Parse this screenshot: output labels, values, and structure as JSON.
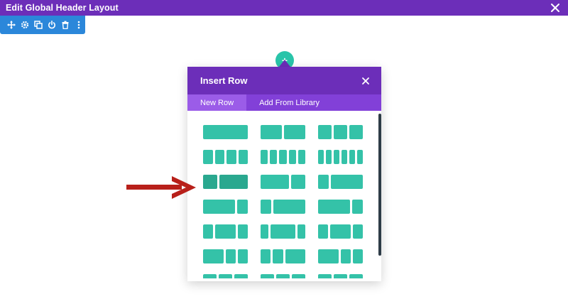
{
  "topbar": {
    "title": "Edit Global Header Layout",
    "close_icon": "close-icon"
  },
  "section_toolbar": {
    "color": "#2b87da",
    "icons": [
      "move-icon",
      "gear-icon",
      "duplicate-icon",
      "power-icon",
      "trash-icon",
      "more-vertical-icon"
    ]
  },
  "add_button": {
    "icon": "plus-icon",
    "label": "+",
    "color": "#29c4a9"
  },
  "modal": {
    "title": "Insert Row",
    "close_icon": "close-icon",
    "tabs": [
      {
        "label": "New Row",
        "active": true
      },
      {
        "label": "Add From Library",
        "active": false
      }
    ],
    "accent": "#6c2eb9",
    "layout_color": "#34c2a8",
    "layouts": [
      {
        "row": 0,
        "col": 0,
        "columns": [
          "1"
        ]
      },
      {
        "row": 0,
        "col": 1,
        "columns": [
          "1/2",
          "1/2"
        ]
      },
      {
        "row": 0,
        "col": 2,
        "columns": [
          "1/3",
          "1/3",
          "1/3"
        ]
      },
      {
        "row": 1,
        "col": 0,
        "columns": [
          "1/4",
          "1/4",
          "1/4",
          "1/4"
        ]
      },
      {
        "row": 1,
        "col": 1,
        "columns": [
          "1/5",
          "1/5",
          "1/5",
          "1/5",
          "1/5"
        ]
      },
      {
        "row": 1,
        "col": 2,
        "columns": [
          "1/6",
          "1/6",
          "1/6",
          "1/6",
          "1/6",
          "1/6"
        ]
      },
      {
        "row": 2,
        "col": 0,
        "columns": [
          "1/3",
          "2/3"
        ],
        "highlighted": true
      },
      {
        "row": 2,
        "col": 1,
        "columns": [
          "2/3",
          "1/3"
        ]
      },
      {
        "row": 2,
        "col": 2,
        "columns": [
          "1/4",
          "3/4"
        ]
      },
      {
        "row": 3,
        "col": 0,
        "columns": [
          "3/4",
          "1/4"
        ]
      },
      {
        "row": 3,
        "col": 1,
        "columns": [
          "1/4",
          "3/4"
        ]
      },
      {
        "row": 3,
        "col": 2,
        "columns": [
          "3/4",
          "1/4"
        ]
      },
      {
        "row": 4,
        "col": 0,
        "columns": [
          "1/4",
          "1/2",
          "1/4"
        ]
      },
      {
        "row": 4,
        "col": 1,
        "columns": [
          "1/5",
          "3/5",
          "1/5"
        ]
      },
      {
        "row": 4,
        "col": 2,
        "columns": [
          "1/4",
          "1/2",
          "1/4"
        ]
      },
      {
        "row": 5,
        "col": 0,
        "columns": [
          "1/2",
          "1/4",
          "1/4"
        ]
      },
      {
        "row": 5,
        "col": 1,
        "columns": [
          "1/4",
          "1/4",
          "1/2"
        ]
      },
      {
        "row": 5,
        "col": 2,
        "columns": [
          "1/2",
          "1/4",
          "1/4"
        ]
      },
      {
        "row": 6,
        "col": 0,
        "columns": [
          "1/3",
          "1/3",
          "1/3"
        ],
        "partial": true
      },
      {
        "row": 6,
        "col": 1,
        "columns": [
          "1/3",
          "1/3",
          "1/3"
        ],
        "partial": true
      },
      {
        "row": 6,
        "col": 2,
        "columns": [
          "1/3",
          "1/3",
          "1/3"
        ],
        "partial": true
      }
    ]
  },
  "annotation": {
    "arrow_color": "#b8201a",
    "arrow_icon": "arrow-right-icon"
  }
}
